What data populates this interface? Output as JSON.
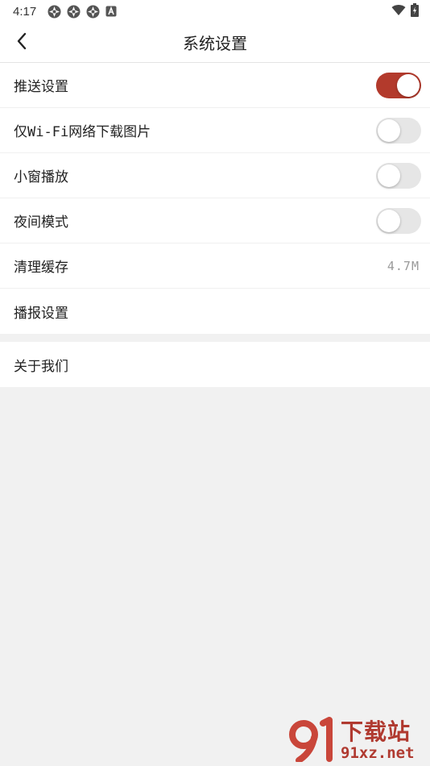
{
  "status_bar": {
    "time": "4:17",
    "notification_icons": [
      "aperture-icon",
      "aperture-icon",
      "aperture-icon",
      "a-badge-icon"
    ],
    "right_icons": [
      "wifi-icon",
      "battery-icon"
    ]
  },
  "app_bar": {
    "back_icon": "chevron-left-icon",
    "title": "系统设置"
  },
  "settings": {
    "push": {
      "label": "推送设置",
      "toggle_on": true
    },
    "wifi_images": {
      "label": "仅Wi-Fi网络下载图片",
      "toggle_on": false
    },
    "mini_window": {
      "label": "小窗播放",
      "toggle_on": false
    },
    "night_mode": {
      "label": "夜间模式",
      "toggle_on": false
    },
    "clear_cache": {
      "label": "清理缓存",
      "value": "4.7M"
    },
    "broadcast": {
      "label": "播报设置"
    }
  },
  "about": {
    "label": "关于我们"
  },
  "watermark": {
    "title": "下载站",
    "url": "91xz.net",
    "logo": "91"
  },
  "colors": {
    "accent": "#b33a2c",
    "toggle_off": "#e6e6e6",
    "background": "#f1f1f1"
  }
}
